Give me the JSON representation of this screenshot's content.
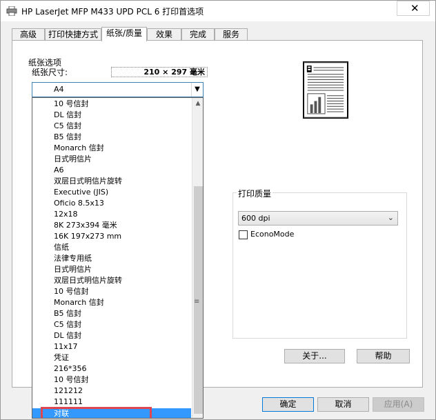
{
  "window": {
    "title": "HP LaserJet MFP M433 UPD PCL 6 打印首选项",
    "close_label": "✕"
  },
  "tabs": [
    {
      "label": "高级"
    },
    {
      "label": "打印快捷方式"
    },
    {
      "label": "纸张/质量"
    },
    {
      "label": "效果"
    },
    {
      "label": "完成"
    },
    {
      "label": "服务"
    }
  ],
  "paper": {
    "group_label": "纸张选项",
    "size_label": "纸张尺寸:",
    "size_value": "210 × 297 毫米",
    "selected": "A4"
  },
  "dropdown": {
    "options": [
      "10 号信封",
      "DL 信封",
      "C5 信封",
      "B5 信封",
      "Monarch 信封",
      "日式明信片",
      "A6",
      "双层日式明信片旋转",
      "Executive (JIS)",
      "Oficio 8.5x13",
      "12x18",
      "8K 273x394 毫米",
      "16K 197x273 mm",
      "信纸",
      "法律专用纸",
      "日式明信片",
      "双层日式明信片旋转",
      "10 号信封",
      "Monarch 信封",
      "B5 信封",
      "C5 信封",
      "DL 信封",
      "11x17",
      "凭证",
      "216*356",
      "10 号信封",
      "121212",
      "111111",
      "对联"
    ],
    "selected_index": 28
  },
  "quality": {
    "group_label": "打印质量",
    "resolution": "600 dpi",
    "econo_label": "EconoMode",
    "econo_checked": false
  },
  "buttons": {
    "about": "关于...",
    "help": "帮助",
    "ok": "确定",
    "cancel": "取消",
    "apply": "应用(A)"
  },
  "colors": {
    "selection": "#3399ff",
    "highlight_outline": "#e0464f",
    "focus_border": "#0078d7"
  }
}
